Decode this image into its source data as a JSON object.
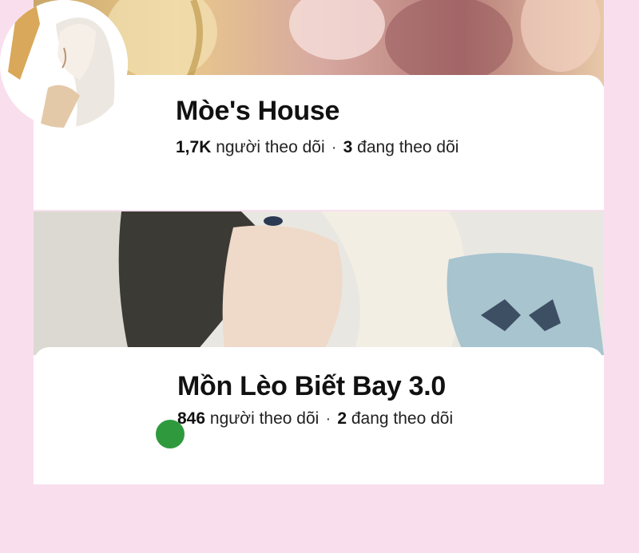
{
  "profiles": [
    {
      "name": "Mòe's House",
      "followers_count": "1,7K",
      "followers_label": "người theo dõi",
      "separator": "·",
      "following_count": "3",
      "following_label": "đang theo dõi",
      "online": false
    },
    {
      "name": "Mồn Lèo Biết Bay 3.0",
      "followers_count": "846",
      "followers_label": "người theo dõi",
      "separator": "·",
      "following_count": "2",
      "following_label": "đang theo dõi",
      "online": true
    }
  ],
  "colors": {
    "background": "#f9dfee",
    "card": "#ffffff",
    "online_status": "#2e9a3d"
  },
  "icons": [
    "cover-photo",
    "profile-avatar",
    "online-status-dot"
  ]
}
